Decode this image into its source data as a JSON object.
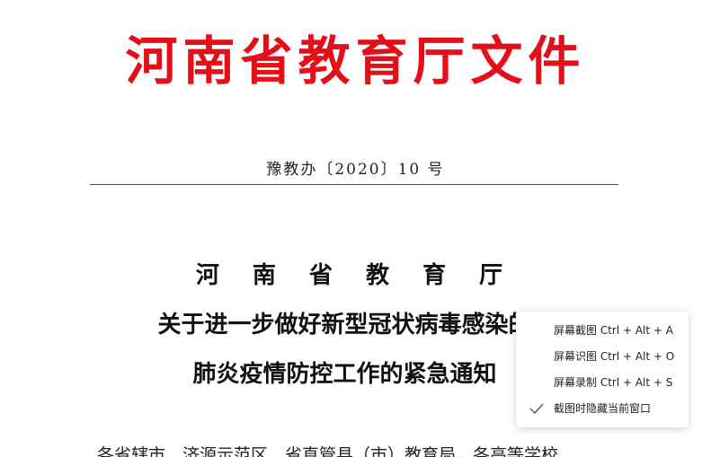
{
  "document": {
    "header": "河南省教育厅文件",
    "doc_number": "豫教办〔2020〕10 号",
    "title_line1": "河 南 省 教 育 厅",
    "title_line2": "关于进一步做好新型冠状病毒感染的",
    "title_line3": "肺炎疫情防控工作的紧急通知",
    "addressee": "各省辖市、济源示范区、省直管县（市）教育局，各高等学校"
  },
  "colors": {
    "header_red": "#e3101a",
    "rule_red": "#e3101a"
  },
  "context_menu": {
    "items": [
      {
        "label": "屏幕截图 Ctrl + Alt + A",
        "checked": false
      },
      {
        "label": "屏幕识图 Ctrl + Alt + O",
        "checked": false
      },
      {
        "label": "屏幕录制 Ctrl + Alt + S",
        "checked": false
      },
      {
        "label": "截图时隐藏当前窗口",
        "checked": true,
        "icon": "check-icon"
      }
    ]
  }
}
